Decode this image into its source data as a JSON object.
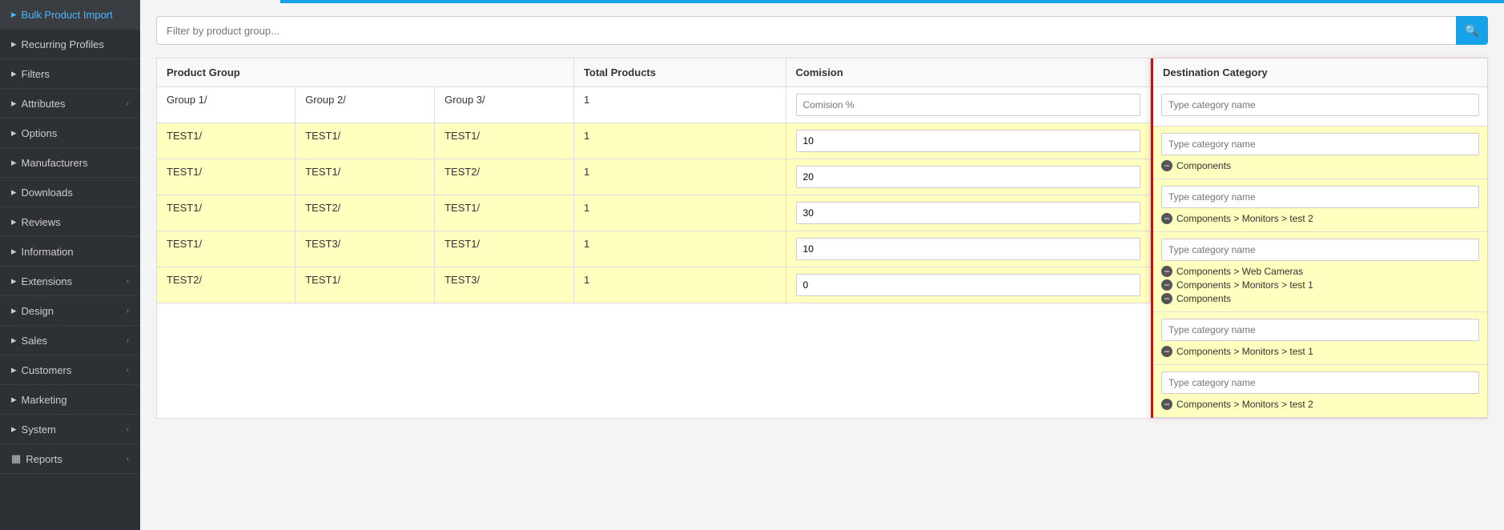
{
  "sidebar": {
    "items": [
      {
        "id": "bulk-product-import",
        "label": "Bulk Product Import",
        "icon": "▶",
        "active": true,
        "hasArrow": false,
        "highlighted": true
      },
      {
        "id": "recurring-profiles",
        "label": "Recurring Profiles",
        "icon": "▶",
        "hasArrow": false
      },
      {
        "id": "filters",
        "label": "Filters",
        "icon": "▶",
        "hasArrow": false
      },
      {
        "id": "attributes",
        "label": "Attributes",
        "icon": "▶",
        "hasArrow": true
      },
      {
        "id": "options",
        "label": "Options",
        "icon": "▶",
        "hasArrow": false
      },
      {
        "id": "manufacturers",
        "label": "Manufacturers",
        "icon": "▶",
        "hasArrow": false
      },
      {
        "id": "downloads",
        "label": "Downloads",
        "icon": "▶",
        "hasArrow": false
      },
      {
        "id": "reviews",
        "label": "Reviews",
        "icon": "▶",
        "hasArrow": false
      },
      {
        "id": "information",
        "label": "Information",
        "icon": "▶",
        "hasArrow": false
      },
      {
        "id": "extensions",
        "label": "Extensions",
        "icon": "▶",
        "hasArrow": true
      },
      {
        "id": "design",
        "label": "Design",
        "icon": "▶",
        "hasArrow": true
      },
      {
        "id": "sales",
        "label": "Sales",
        "icon": "▶",
        "hasArrow": true
      },
      {
        "id": "customers",
        "label": "Customers",
        "icon": "▶",
        "hasArrow": true
      },
      {
        "id": "marketing",
        "label": "Marketing",
        "icon": "▶",
        "hasArrow": false
      },
      {
        "id": "system",
        "label": "System",
        "icon": "▶",
        "hasArrow": true
      },
      {
        "id": "reports",
        "label": "Reports",
        "icon": "📊",
        "hasArrow": true
      }
    ]
  },
  "search": {
    "placeholder": "Filter by product group..."
  },
  "table": {
    "columns": {
      "product_group": "Product Group",
      "total_products": "Total Products",
      "commission": "Comision"
    },
    "rows": [
      {
        "id": "row1",
        "groups": [
          "Group 1/",
          "Group 2/",
          "Group 3/"
        ],
        "total": "1",
        "commission": "",
        "commission_placeholder": "Comision %",
        "yellow": false,
        "dest_input_placeholder": "Type category name",
        "dest_tags": []
      },
      {
        "id": "row2",
        "groups": [
          "TEST1/",
          "TEST1/",
          "TEST1/"
        ],
        "total": "1",
        "commission": "10",
        "commission_placeholder": "",
        "yellow": true,
        "dest_input_placeholder": "Type category name",
        "dest_tags": [
          "Components"
        ]
      },
      {
        "id": "row3",
        "groups": [
          "TEST1/",
          "TEST1/",
          "TEST2/"
        ],
        "total": "1",
        "commission": "20",
        "commission_placeholder": "",
        "yellow": true,
        "dest_input_placeholder": "Type category name",
        "dest_tags": [
          "Components > Monitors > test 2"
        ]
      },
      {
        "id": "row4",
        "groups": [
          "TEST1/",
          "TEST2/",
          "TEST1/"
        ],
        "total": "1",
        "commission": "30",
        "commission_placeholder": "",
        "yellow": true,
        "dest_input_placeholder": "Type category name",
        "dest_tags": [
          "Components > Web Cameras",
          "Components > Monitors > test 1",
          "Components"
        ]
      },
      {
        "id": "row5",
        "groups": [
          "TEST1/",
          "TEST3/",
          "TEST1/"
        ],
        "total": "1",
        "commission": "10",
        "commission_placeholder": "",
        "yellow": true,
        "dest_input_placeholder": "Type category name",
        "dest_tags": [
          "Components > Monitors > test 1"
        ]
      },
      {
        "id": "row6",
        "groups": [
          "TEST2/",
          "TEST1/",
          "TEST3/"
        ],
        "total": "1",
        "commission": "0",
        "commission_placeholder": "",
        "yellow": true,
        "dest_input_placeholder": "Type category name",
        "dest_tags": [
          "Components > Monitors > test 2"
        ]
      }
    ]
  },
  "destination_category": {
    "header": "Destination Category"
  }
}
